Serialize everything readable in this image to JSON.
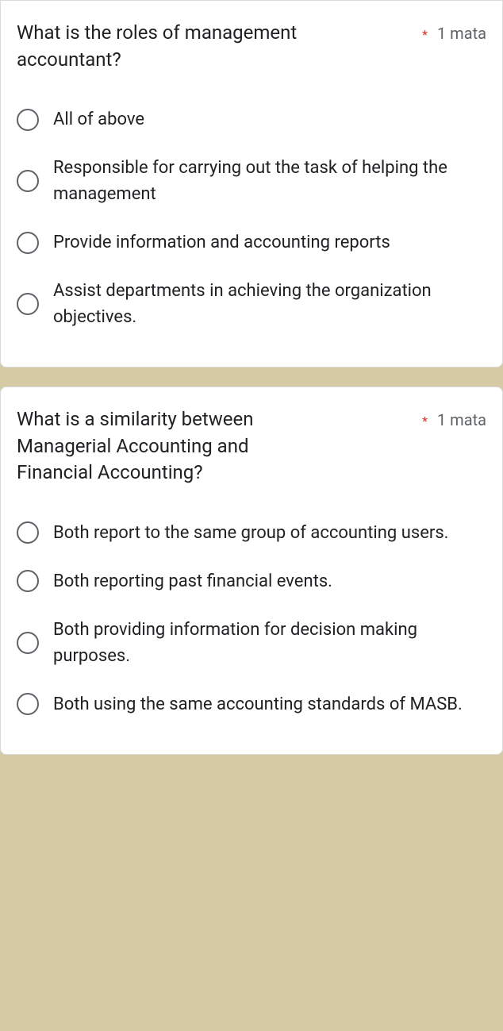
{
  "questions": [
    {
      "title_line1": "What is the roles of management",
      "title_line2": "accountant?",
      "required_mark": "*",
      "points": "1 mata",
      "options": [
        "All of above",
        "Responsible for carrying out the task of helping the management",
        "Provide information and accounting reports",
        "Assist departments in achieving the organization objectives."
      ]
    },
    {
      "title_line1": "What is a similarity between",
      "title_line2": "Managerial Accounting and",
      "title_line3": "Financial Accounting?",
      "required_mark": "*",
      "points": "1 mata",
      "options": [
        "Both report to the same group of accounting users.",
        "Both reporting past financial events.",
        "Both providing information for decision making purposes.",
        "Both using the same accounting standards of MASB."
      ]
    }
  ]
}
